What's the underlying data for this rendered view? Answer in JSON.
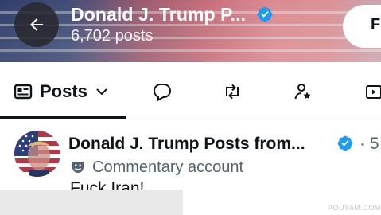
{
  "header": {
    "name": "Donald J. Trump P...",
    "post_count": "6,702 posts",
    "follow_label": "F"
  },
  "tabs": {
    "active_label": "Posts",
    "items": [
      "posts",
      "replies",
      "reposts",
      "affiliates",
      "media"
    ]
  },
  "post": {
    "author": "Donald J. Trump Posts from...",
    "time": "· 5",
    "account_type": "Commentary account",
    "text": "Fuck Iran!"
  },
  "watermark": "POUYAM.COM",
  "colors": {
    "verified": "#1d9bf0",
    "text_primary": "#0f1419",
    "text_secondary": "#536471"
  }
}
